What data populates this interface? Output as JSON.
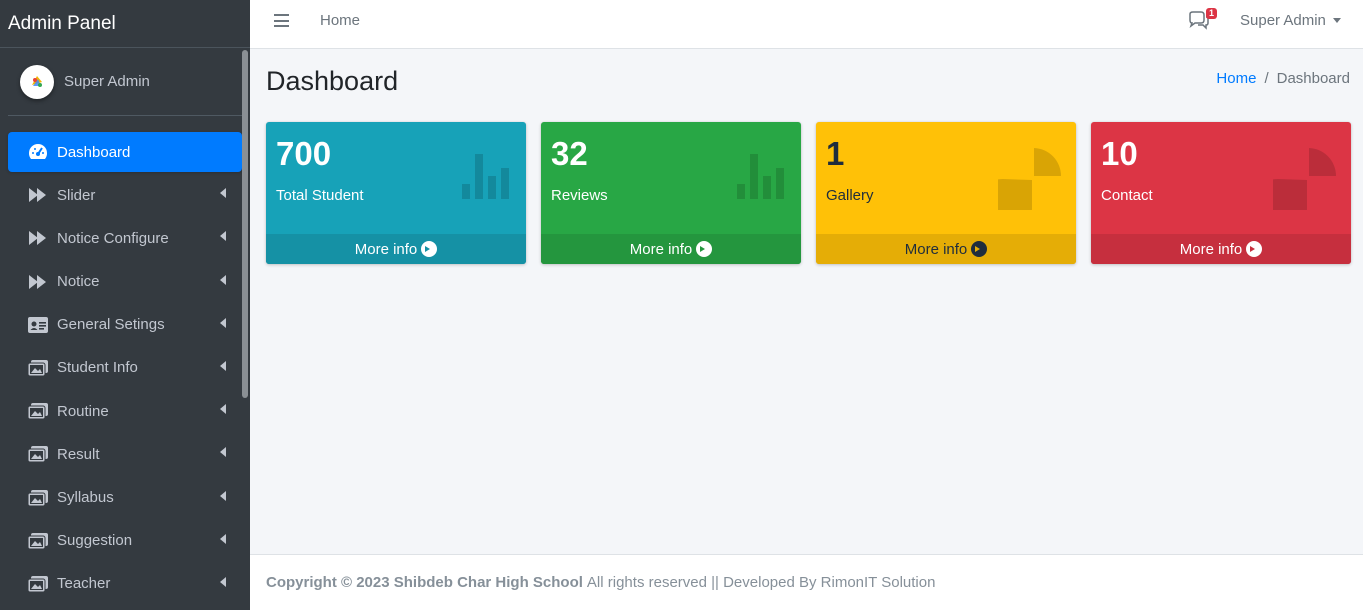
{
  "brand": {
    "title": "Admin Panel"
  },
  "user": {
    "name": "Super Admin"
  },
  "sidebar": {
    "items": [
      {
        "label": "Dashboard",
        "icon": "tachometer-icon",
        "active": true
      },
      {
        "label": "Slider",
        "icon": "fast-forward-icon"
      },
      {
        "label": "Notice Configure",
        "icon": "fast-forward-icon"
      },
      {
        "label": "Notice",
        "icon": "fast-forward-icon"
      },
      {
        "label": "General Setings",
        "icon": "id-card-icon"
      },
      {
        "label": "Student Info",
        "icon": "images-icon"
      },
      {
        "label": "Routine",
        "icon": "images-icon"
      },
      {
        "label": "Result",
        "icon": "images-icon"
      },
      {
        "label": "Syllabus",
        "icon": "images-icon"
      },
      {
        "label": "Suggestion",
        "icon": "images-icon"
      },
      {
        "label": "Teacher",
        "icon": "images-icon"
      }
    ]
  },
  "topbar": {
    "home_link": "Home",
    "notification_count": "1",
    "user_menu": "Super Admin"
  },
  "page": {
    "title": "Dashboard",
    "breadcrumb": {
      "home": "Home",
      "separator": "/",
      "current": "Dashboard"
    }
  },
  "boxes": [
    {
      "value": "700",
      "label": "Total Student",
      "footer": "More info",
      "color": "#17a2b8",
      "icon": "bar-chart-icon"
    },
    {
      "value": "32",
      "label": "Reviews",
      "footer": "More info",
      "color": "#28a745",
      "icon": "bar-chart-icon"
    },
    {
      "value": "1",
      "label": "Gallery",
      "footer": "More info",
      "color": "#ffc107",
      "icon": "pie-chart-icon"
    },
    {
      "value": "10",
      "label": "Contact",
      "footer": "More info",
      "color": "#dc3545",
      "icon": "pie-chart-icon"
    }
  ],
  "footer": {
    "copyright": "Copyright © 2023 Shibdeb Char High School",
    "rest": "All rights reserved || Developed By RimonIT Solution"
  }
}
